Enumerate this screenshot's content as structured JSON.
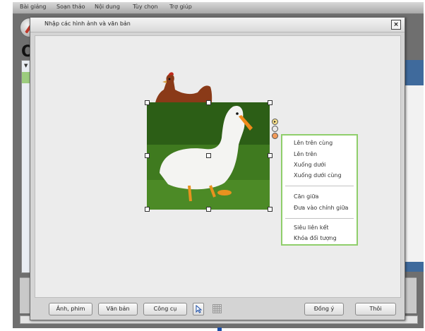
{
  "menubar": {
    "items": [
      "Bài giảng",
      "Soạn thảo",
      "Nội dung",
      "Tùy chọn",
      "Trợ giúp"
    ]
  },
  "app": {
    "heading_fragment": "OC"
  },
  "dialog": {
    "title": "Nhập các hình ảnh và văn bản",
    "close_label": "×"
  },
  "context_menu": {
    "group1": [
      "Lên trên cùng",
      "Lên trên",
      "Xuống dưới",
      "Xuống dưới cùng"
    ],
    "group2": [
      "Căn giữa",
      "Đưa vào chính giữa"
    ],
    "group3": [
      "Siêu liên kết",
      "Khóa đối tượng"
    ]
  },
  "buttons": {
    "images_media": "Ảnh, phim",
    "text": "Văn bản",
    "tools": "Công cụ",
    "ok": "Đồng ý",
    "cancel": "Thôi"
  },
  "colors": {
    "menu_border": "#8fce6b",
    "grass": "#3f7a1f",
    "accent_blue": "#1c4fa8"
  },
  "icons": {
    "close": "close-icon",
    "pointer": "cursor-arrow-icon",
    "grid": "grid-icon",
    "logo": "pen-logo-icon"
  }
}
